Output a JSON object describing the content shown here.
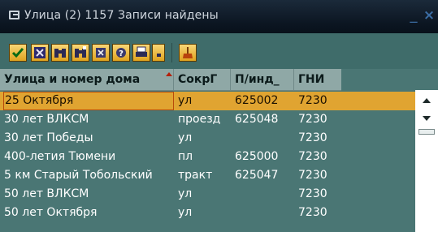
{
  "window": {
    "title": "Улица (2) 1157 Записи найдены",
    "minimize_glyph": "_",
    "close_glyph": "×"
  },
  "toolbar": {
    "buttons": [
      {
        "icon": "checkmark-icon"
      },
      {
        "icon": "cancel-icon"
      },
      {
        "icon": "binoculars-icon"
      },
      {
        "icon": "find-next-icon"
      },
      {
        "icon": "sort-icon"
      },
      {
        "icon": "help-icon"
      },
      {
        "icon": "print-icon"
      },
      {
        "icon": "print-options-icon"
      },
      {
        "icon": "broom-icon"
      }
    ]
  },
  "table": {
    "columns": [
      "Улица и номер дома",
      "СокрГ",
      "П/инд_",
      "ГНИ"
    ],
    "rows": [
      [
        "25 Октября",
        "ул",
        "625002",
        "7230"
      ],
      [
        "30 лет ВЛКСМ",
        "проезд",
        "625048",
        "7230"
      ],
      [
        "30 лет Победы",
        "ул",
        "",
        "7230"
      ],
      [
        "400-летия Тюмени",
        "пл",
        "625000",
        "7230"
      ],
      [
        "5 км Старый Тобольский",
        "тракт",
        "625047",
        "7230"
      ],
      [
        "50 лет ВЛКСМ",
        "ул",
        "",
        "7230"
      ],
      [
        "50 лет Октября",
        "ул",
        "",
        "7230"
      ]
    ],
    "selected_row": 0
  },
  "colors": {
    "background": "#4a7674",
    "selection": "#e0a431",
    "header": "#8fa8a6",
    "title_bar": "#0c1622"
  }
}
